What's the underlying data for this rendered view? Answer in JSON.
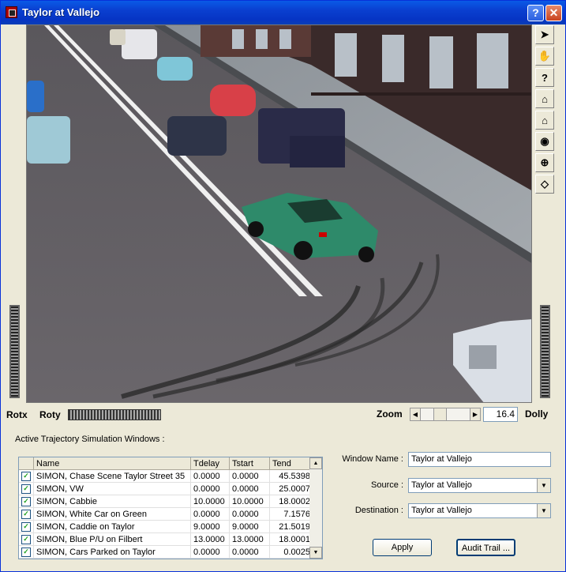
{
  "window": {
    "title": "Taylor at Vallejo",
    "help_label": "?",
    "close_label": "✕"
  },
  "viewer": {
    "tools": [
      "select-arrow-icon",
      "hand-pan-icon",
      "help-question-icon",
      "home-icon",
      "set-home-icon",
      "view-all-icon",
      "seek-icon",
      "perspective-icon"
    ],
    "rotx_label": "Rotx",
    "roty_label": "Roty",
    "zoom_label": "Zoom",
    "zoom_value": "16.4",
    "dolly_label": "Dolly"
  },
  "trajectory": {
    "section_label": "Active Trajectory Simulation Windows :",
    "columns": [
      "",
      "Name",
      "Tdelay",
      "Tstart",
      "Tend"
    ],
    "rows": [
      {
        "checked": true,
        "name": "SIMON, Chase Scene Taylor Street 35",
        "tdelay": "0.0000",
        "tstart": "0.0000",
        "tend": "45.5398"
      },
      {
        "checked": true,
        "name": "SIMON, VW",
        "tdelay": "0.0000",
        "tstart": "0.0000",
        "tend": "25.0007"
      },
      {
        "checked": true,
        "name": "SIMON, Cabbie",
        "tdelay": "10.0000",
        "tstart": "10.0000",
        "tend": "18.0002"
      },
      {
        "checked": true,
        "name": "SIMON, White Car on Green",
        "tdelay": "0.0000",
        "tstart": "0.0000",
        "tend": "7.1576"
      },
      {
        "checked": true,
        "name": "SIMON, Caddie on Taylor",
        "tdelay": "9.0000",
        "tstart": "9.0000",
        "tend": "21.5019"
      },
      {
        "checked": true,
        "name": "SIMON, Blue P/U on Filbert",
        "tdelay": "13.0000",
        "tstart": "13.0000",
        "tend": "18.0001"
      },
      {
        "checked": true,
        "name": "SIMON, Cars Parked on Taylor",
        "tdelay": "0.0000",
        "tstart": "0.0000",
        "tend": "0.0025"
      }
    ]
  },
  "form": {
    "window_name_label": "Window Name :",
    "window_name_value": "Taylor at Vallejo",
    "source_label": "Source :",
    "source_value": "Taylor at Vallejo",
    "destination_label": "Destination :",
    "destination_value": "Taylor at Vallejo",
    "apply_label": "Apply",
    "audit_label": "Audit Trail ..."
  }
}
